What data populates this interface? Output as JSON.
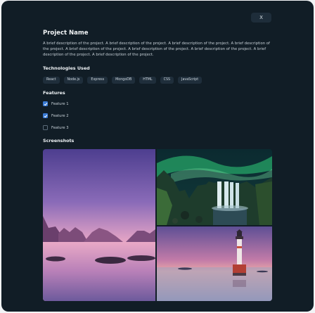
{
  "modal": {
    "close_label": "X",
    "title": "Project Name",
    "description": "A brief description of the project. A brief description of the project. A brief description of the project. A brief description of the project. A brief description of the project. A brief description of the project. A brief description of the project. A brief description of the project. A brief description of the project."
  },
  "technologies": {
    "heading": "Technologies Used",
    "items": [
      "React",
      "Node.js",
      "Express",
      "MongoDB",
      "HTML",
      "CSS",
      "JavaScript"
    ]
  },
  "features": {
    "heading": "Features",
    "items": [
      {
        "label": "Feature 1",
        "checked": true
      },
      {
        "label": "Feature 2",
        "checked": true
      },
      {
        "label": "Feature 3",
        "checked": false
      }
    ]
  },
  "screenshots": {
    "heading": "Screenshots",
    "images": [
      "pink-sunset-lake",
      "aurora-waterfall",
      "lighthouse-sunset"
    ]
  },
  "colors": {
    "modal_bg": "#111d26",
    "tag_bg": "#1f2e3b",
    "checkbox_accent": "#3a7bd5"
  }
}
